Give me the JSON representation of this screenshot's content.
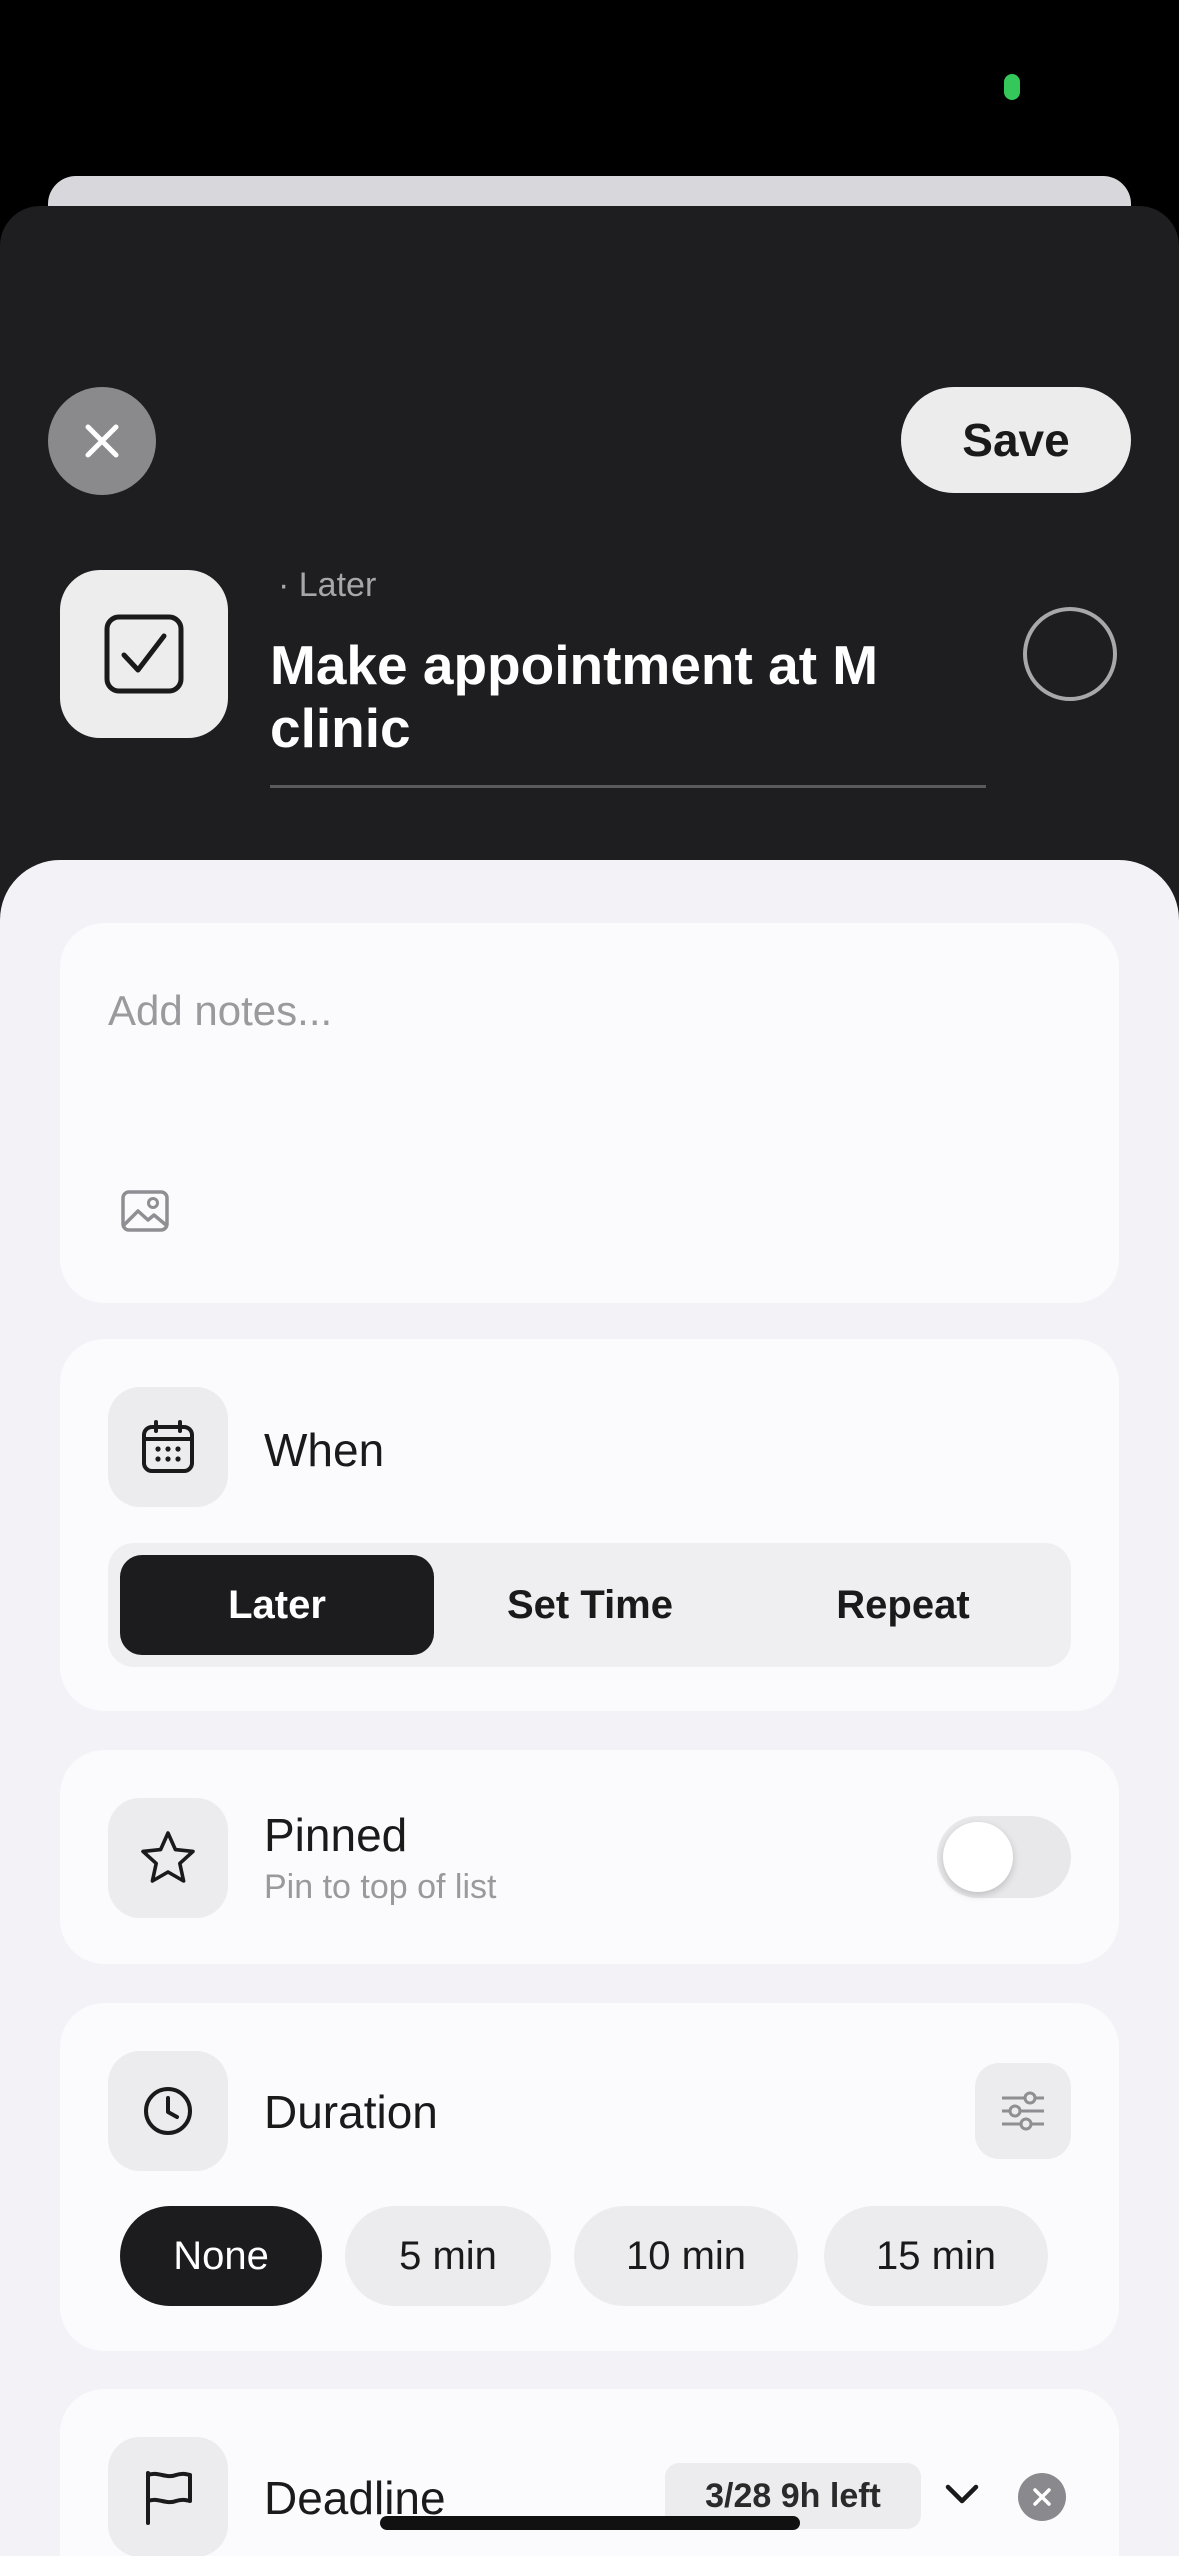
{
  "header": {
    "save_label": "Save",
    "subtitle": "· Later",
    "task_title": "Make appointment at M clinic"
  },
  "notes": {
    "placeholder": "Add notes..."
  },
  "when": {
    "title": "When",
    "options": [
      "Later",
      "Set Time",
      "Repeat"
    ],
    "selected": "Later"
  },
  "pinned": {
    "title": "Pinned",
    "subtitle": "Pin to top of list",
    "enabled": false
  },
  "duration": {
    "title": "Duration",
    "options": [
      "None",
      "5 min",
      "10 min",
      "15 min"
    ],
    "selected": "None"
  },
  "deadline": {
    "title": "Deadline",
    "badge": "3/28 9h left"
  },
  "colors": {
    "accent_dark": "#1c1c1e",
    "status_green": "#34c759"
  }
}
